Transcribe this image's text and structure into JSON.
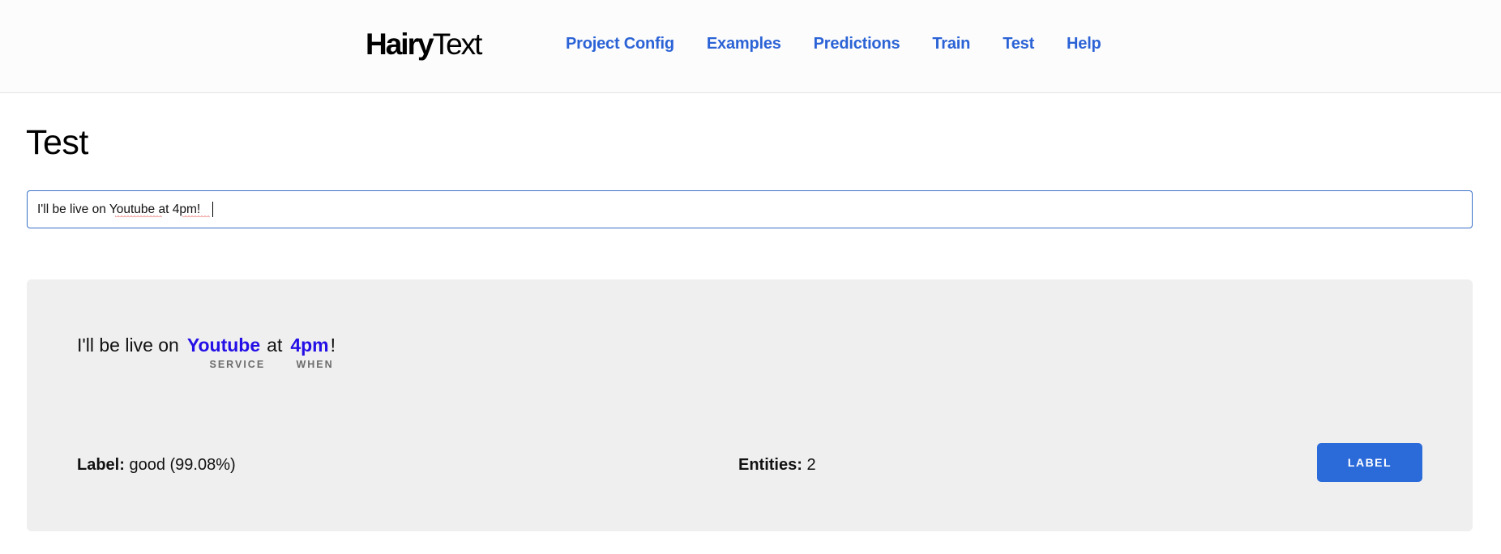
{
  "app": {
    "logo_bold": "Hairy",
    "logo_regular": "Text"
  },
  "nav": {
    "items": [
      {
        "label": "Project Config"
      },
      {
        "label": "Examples"
      },
      {
        "label": "Predictions"
      },
      {
        "label": "Train"
      },
      {
        "label": "Test"
      },
      {
        "label": "Help"
      }
    ],
    "link_color": "#2b63d6"
  },
  "page": {
    "title": "Test"
  },
  "test_input": {
    "value": "I'll be live on Youtube at 4pm!",
    "misspelled": [
      "Youtube",
      "4pm"
    ]
  },
  "result": {
    "sentence": {
      "before": "I'll be live on",
      "middle": "at",
      "after": "!",
      "entities": [
        {
          "text": "Youtube",
          "tag": "SERVICE"
        },
        {
          "text": "4pm",
          "tag": "WHEN"
        }
      ],
      "entity_color": "#2410e6"
    },
    "label_key": "Label:",
    "label_value": "good (99.08%)",
    "entities_key": "Entities:",
    "entities_value": "2",
    "label_button": "LABEL",
    "button_color": "#2b6ad9"
  }
}
